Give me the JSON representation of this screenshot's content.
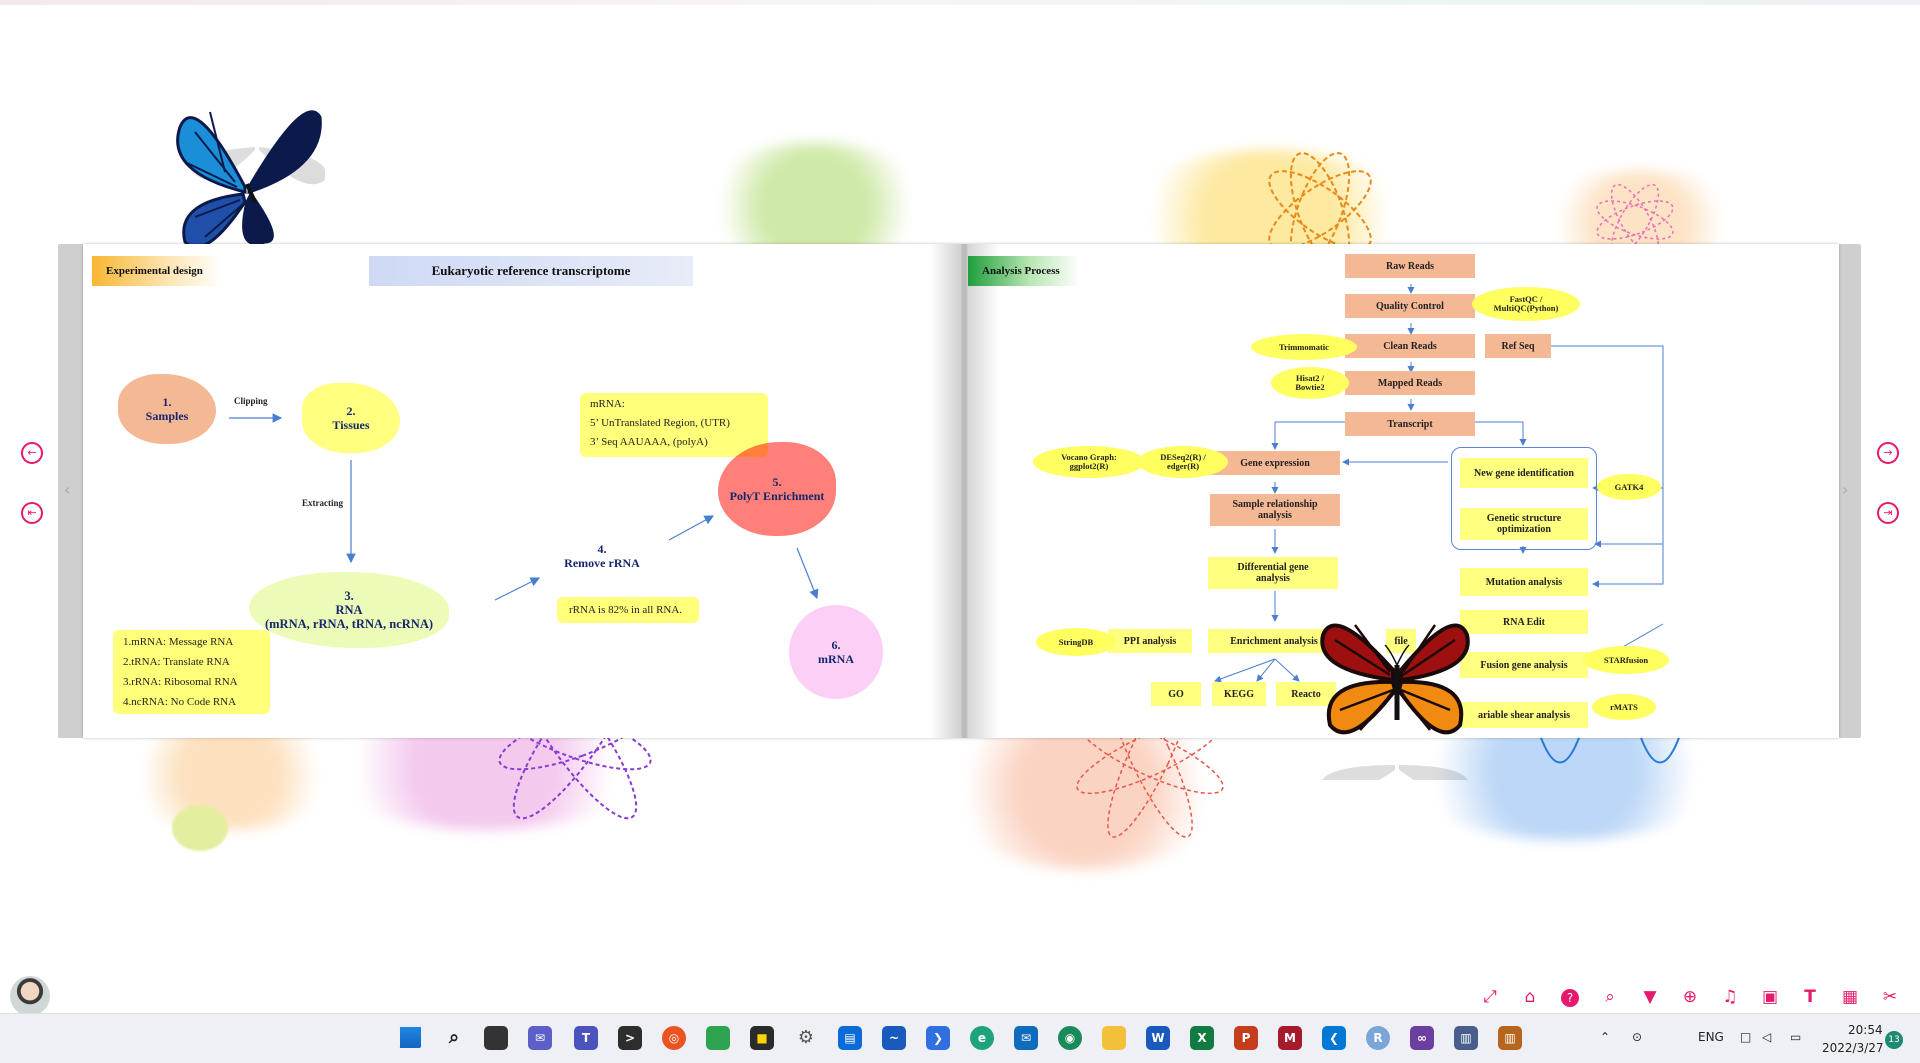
{
  "left_page": {
    "header": "Experimental design",
    "title": "Eukaryotic reference transcriptome",
    "samples": "1.\nSamples",
    "clipping": "Clipping",
    "tissues": "2.\nTissues",
    "extracting": "Extracting",
    "rna": "3.\nRNA\n(mRNA, rRNA, tRNA, ncRNA)",
    "rna_types": [
      "1.mRNA: Message RNA",
      "2.tRNA: Translate RNA",
      "3.rRNA: Ribosomal RNA",
      "4.ncRNA: No Code RNA"
    ],
    "remove_rrna": "4.\nRemove rRNA",
    "rrna_note": "rRNA is 82% in all RNA.",
    "mrna_note": [
      "mRNA:",
      "5’ UnTranslated Region, (UTR)",
      "3’ Seq AAUAAA, (polyA)"
    ],
    "polyt": "5.\nPolyT Enrichment",
    "mrna": "6.\nmRNA"
  },
  "right_page": {
    "header": "Analysis Process",
    "raw_reads": "Raw Reads",
    "quality_control": "Quality Control",
    "fastqc": "FastQC /\nMultiQC(Python)",
    "clean_reads": "Clean Reads",
    "trimmomatic": "Trimmomatic",
    "ref_seq": "Ref Seq",
    "mapped_reads": "Mapped Reads",
    "hisat": "Hisat2 /\nBowtie2",
    "transcript": "Transcript",
    "gene_expression": "Gene expression",
    "deseq": "DESeq2(R) /\nedger(R)",
    "vocano": "Vocano Graph:\nggplot2(R)",
    "sample_relationship": "Sample relationship\nanalysis",
    "differential": "Differential gene\nanalysis",
    "enrichment": "Enrichment analysis",
    "ppi": "PPI analysis",
    "stringdb": "StringDB",
    "go": "GO",
    "kegg": "KEGG",
    "reactome": "Reacto",
    "profile_fragment": "file",
    "new_gene": "New gene identification",
    "genetic_structure": "Genetic structure\noptimization",
    "gatk4": "GATK4",
    "mutation": "Mutation analysis",
    "rna_edit": "RNA Edit",
    "fusion": "Fusion gene analysis",
    "starfusion": "STARfusion",
    "variable_shear": "ariable shear analysis",
    "rmats": "rMATS"
  },
  "taskbar": {
    "lang": "ENG",
    "time": "20:54",
    "date": "2022/3/27",
    "notifications": "13"
  },
  "icons": {
    "nav_prev": "arrow-left-icon",
    "nav_first": "skip-first-icon",
    "nav_next": "arrow-right-icon",
    "nav_last": "skip-last-icon",
    "toolbar": [
      "fullscreen-icon",
      "home-icon",
      "help-icon",
      "search-icon",
      "bookmark-icon",
      "zoom-icon",
      "sound-icon",
      "slideshow-icon",
      "text-icon",
      "thumbnails-icon",
      "crop-icon"
    ]
  },
  "colors": {
    "accent": "#e6196e",
    "salmon": "#f5b895",
    "yellow": "#ffff80",
    "navy": "#16276b"
  }
}
